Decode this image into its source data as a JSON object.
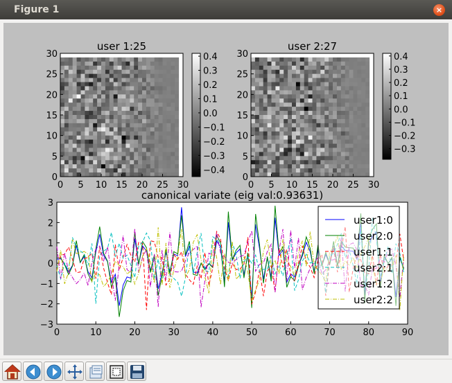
{
  "window": {
    "title": "Figure 1",
    "close_label": "×"
  },
  "toolbar": {
    "buttons": [
      "home-icon",
      "back-arrow-icon",
      "forward-arrow-icon",
      "pan-icon",
      "configure-subplots-icon",
      "zoom-rect-icon",
      "save-icon"
    ]
  },
  "chart_data": [
    {
      "type": "heatmap",
      "title": "user 1:25",
      "xlim": [
        0,
        30
      ],
      "ylim": [
        0,
        30
      ],
      "xticks": [
        "0",
        "5",
        "10",
        "15",
        "20",
        "25",
        "30"
      ],
      "yticks": [
        "0",
        "5",
        "10",
        "15",
        "20",
        "25",
        "30"
      ],
      "colorbar": {
        "range": [
          -0.45,
          0.42
        ],
        "ticks": [
          "0.4",
          "0.3",
          "0.2",
          "0.1",
          "0.0",
          "−0.1",
          "−0.2",
          "−0.3",
          "−0.4"
        ]
      },
      "colormap": "gray",
      "note_cells": "29x29 grid; columns beyond ~20 fade to neutral gray"
    },
    {
      "type": "heatmap",
      "title": "user 2:27",
      "xlim": [
        0,
        30
      ],
      "ylim": [
        0,
        30
      ],
      "xticks": [
        "0",
        "5",
        "10",
        "15",
        "20",
        "25",
        "30"
      ],
      "yticks": [
        "0",
        "5",
        "10",
        "15",
        "20",
        "25",
        "30"
      ],
      "colorbar": {
        "range": [
          -0.38,
          0.42
        ],
        "ticks": [
          "0.4",
          "0.3",
          "0.2",
          "0.1",
          "0.0",
          "−0.1",
          "−0.2",
          "−0.3"
        ]
      },
      "colormap": "gray"
    },
    {
      "type": "line",
      "title": "canonical variate (eig val:0.93631)",
      "xlim": [
        0,
        90
      ],
      "ylim": [
        -3,
        3
      ],
      "xticks": [
        "0",
        "10",
        "20",
        "30",
        "40",
        "50",
        "60",
        "70",
        "80",
        "90"
      ],
      "yticks": [
        "3",
        "2",
        "1",
        "0",
        "−1",
        "−2",
        "−3"
      ],
      "legend_position": "top-right",
      "series": [
        {
          "name": "user1:0",
          "color": "#0000ff",
          "style": "solid"
        },
        {
          "name": "user2:0",
          "color": "#008000",
          "style": "solid"
        },
        {
          "name": "user1:1",
          "color": "#ff0000",
          "style": "dashed"
        },
        {
          "name": "user2:1",
          "color": "#00bfbf",
          "style": "dashed"
        },
        {
          "name": "user1:2",
          "color": "#bf00bf",
          "style": "dashdot"
        },
        {
          "name": "user2:2",
          "color": "#bfbf00",
          "style": "dashdot"
        }
      ]
    }
  ]
}
